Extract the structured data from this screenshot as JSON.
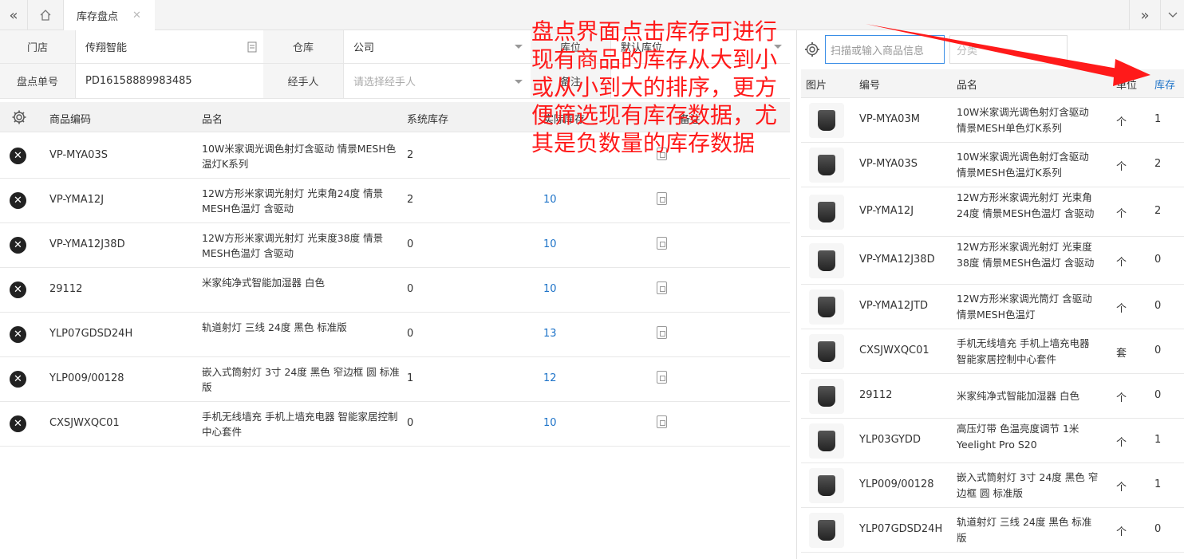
{
  "tabbar": {
    "collapse_icon": "double-chevron-left",
    "home_icon": "home",
    "active_tab": "库存盘点",
    "close_icon": "close",
    "expand_icon": "double-chevron-right",
    "more_icon": "chevron-down"
  },
  "form": {
    "store_label": "门店",
    "store_value": "传翔智能",
    "warehouse_label": "仓库",
    "warehouse_value": "公司",
    "location_label": "库位",
    "location_value": "默认库位",
    "order_label": "盘点单号",
    "order_value": "PD16158889983485",
    "handler_label": "经手人",
    "handler_placeholder": "请选择经手人",
    "remark_label": "备注"
  },
  "left_table": {
    "columns": [
      "商品编码",
      "品名",
      "系统库存",
      "实际库存",
      "备注"
    ],
    "rows": [
      {
        "code": "VP-MYA03S",
        "name": "10W米家调光调色射灯含驱动 情景MESH色温灯K系列",
        "system": "2",
        "actual": ""
      },
      {
        "code": "VP-YMA12J",
        "name": "12W方形米家调光射灯 光束角24度 情景MESH色温灯 含驱动",
        "system": "2",
        "actual": "10"
      },
      {
        "code": "VP-YMA12J38D",
        "name": "12W方形米家调光射灯 光束度38度 情景MESH色温灯 含驱动",
        "system": "0",
        "actual": "10"
      },
      {
        "code": "29112",
        "name": "米家纯净式智能加湿器 白色",
        "system": "0",
        "actual": "10"
      },
      {
        "code": "YLP07GDSD24H",
        "name": "轨道射灯 三线 24度 黑色 标准版",
        "system": "0",
        "actual": "13"
      },
      {
        "code": "YLP009/00128",
        "name": "嵌入式筒射灯 3寸 24度 黑色 窄边框 圆 标准版",
        "system": "1",
        "actual": "12"
      },
      {
        "code": "CXSJWXQC01",
        "name": "手机无线墙充 手机上墙充电器 智能家居控制中心套件",
        "system": "0",
        "actual": "10"
      }
    ]
  },
  "right_panel": {
    "scan_placeholder": "扫描或输入商品信息",
    "category_placeholder": "分类",
    "columns": [
      "图片",
      "编号",
      "品名",
      "单位",
      "库存"
    ],
    "rows": [
      {
        "code": "VP-MYA03M",
        "name": "10W米家调光调色射灯含驱动 情景MESH单色灯K系列",
        "unit": "个",
        "stock": "1"
      },
      {
        "code": "VP-MYA03S",
        "name": "10W米家调光调色射灯含驱动 情景MESH色温灯K系列",
        "unit": "个",
        "stock": "2"
      },
      {
        "code": "VP-YMA12J",
        "name": "12W方形米家调光射灯 光束角24度 情景MESH色温灯 含驱动",
        "unit": "个",
        "stock": "2"
      },
      {
        "code": "VP-YMA12J38D",
        "name": "12W方形米家调光射灯 光束度38度 情景MESH色温灯 含驱动",
        "unit": "个",
        "stock": "0"
      },
      {
        "code": "VP-YMA12JTD",
        "name": "12W方形米家调光筒灯 含驱动 情景MESH色温灯",
        "unit": "个",
        "stock": "0"
      },
      {
        "code": "CXSJWXQC01",
        "name": "手机无线墙充 手机上墙充电器 智能家居控制中心套件",
        "unit": "套",
        "stock": "0"
      },
      {
        "code": "29112",
        "name": "米家纯净式智能加湿器 白色",
        "unit": "个",
        "stock": "0"
      },
      {
        "code": "YLP03GYDD",
        "name": "高压灯带 色温亮度调节 1米 Yeelight Pro S20",
        "unit": "个",
        "stock": "1"
      },
      {
        "code": "YLP009/00128",
        "name": "嵌入式筒射灯 3寸 24度 黑色 窄边框 圆 标准版",
        "unit": "个",
        "stock": "1"
      },
      {
        "code": "YLP07GDSD24H",
        "name": "轨道射灯 三线 24度 黑色 标准版",
        "unit": "个",
        "stock": "0"
      }
    ]
  },
  "annotation": {
    "lines": [
      "盘点界面点击库存可进行",
      "现有商品的库存从大到小",
      "或从小到大的排序，更方",
      "便筛选现有库存数据，尤",
      "其是负数量的库存数据"
    ],
    "color": "#ff1a1a"
  }
}
